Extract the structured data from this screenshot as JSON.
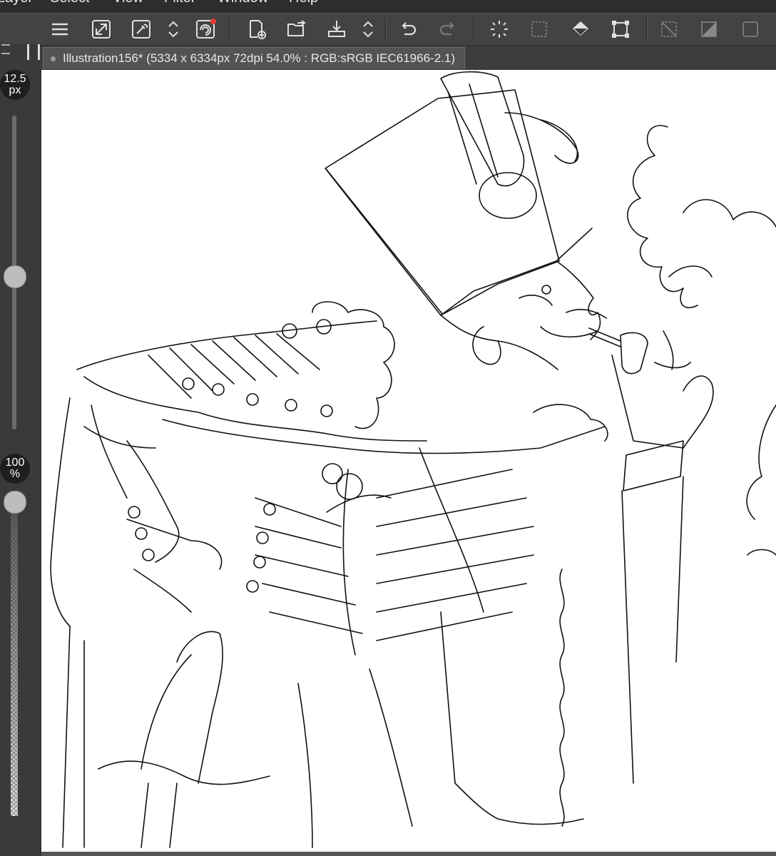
{
  "menu": [
    "Layer",
    "Select",
    "View",
    "Filter",
    "Window",
    "Help"
  ],
  "toolbar": {
    "icons": [
      "hamburger-icon",
      "fit-icon",
      "eyedropper-icon",
      "updown-icon",
      "companion-icon",
      "new-doc-icon",
      "open-icon",
      "export-icon",
      "updown-icon",
      "undo-icon",
      "redo-icon",
      "loading-icon",
      "deselect-icon",
      "fill-icon",
      "transform-icon",
      "clear-selection-icon",
      "gradient-icon",
      "frame-icon"
    ]
  },
  "tab": {
    "title": "Illustration156* (5334 x 6334px 72dpi 54.0% : RGB:sRGB IEC61966-2.1)"
  },
  "brush": {
    "size_value": "12.5",
    "size_unit": "px",
    "opacity_value": "100",
    "opacity_unit": "%"
  },
  "colors": {
    "toolbar": "#434343",
    "panel": "#3a3a3a",
    "canvas": "#ffffff",
    "accent": "#e53935"
  }
}
